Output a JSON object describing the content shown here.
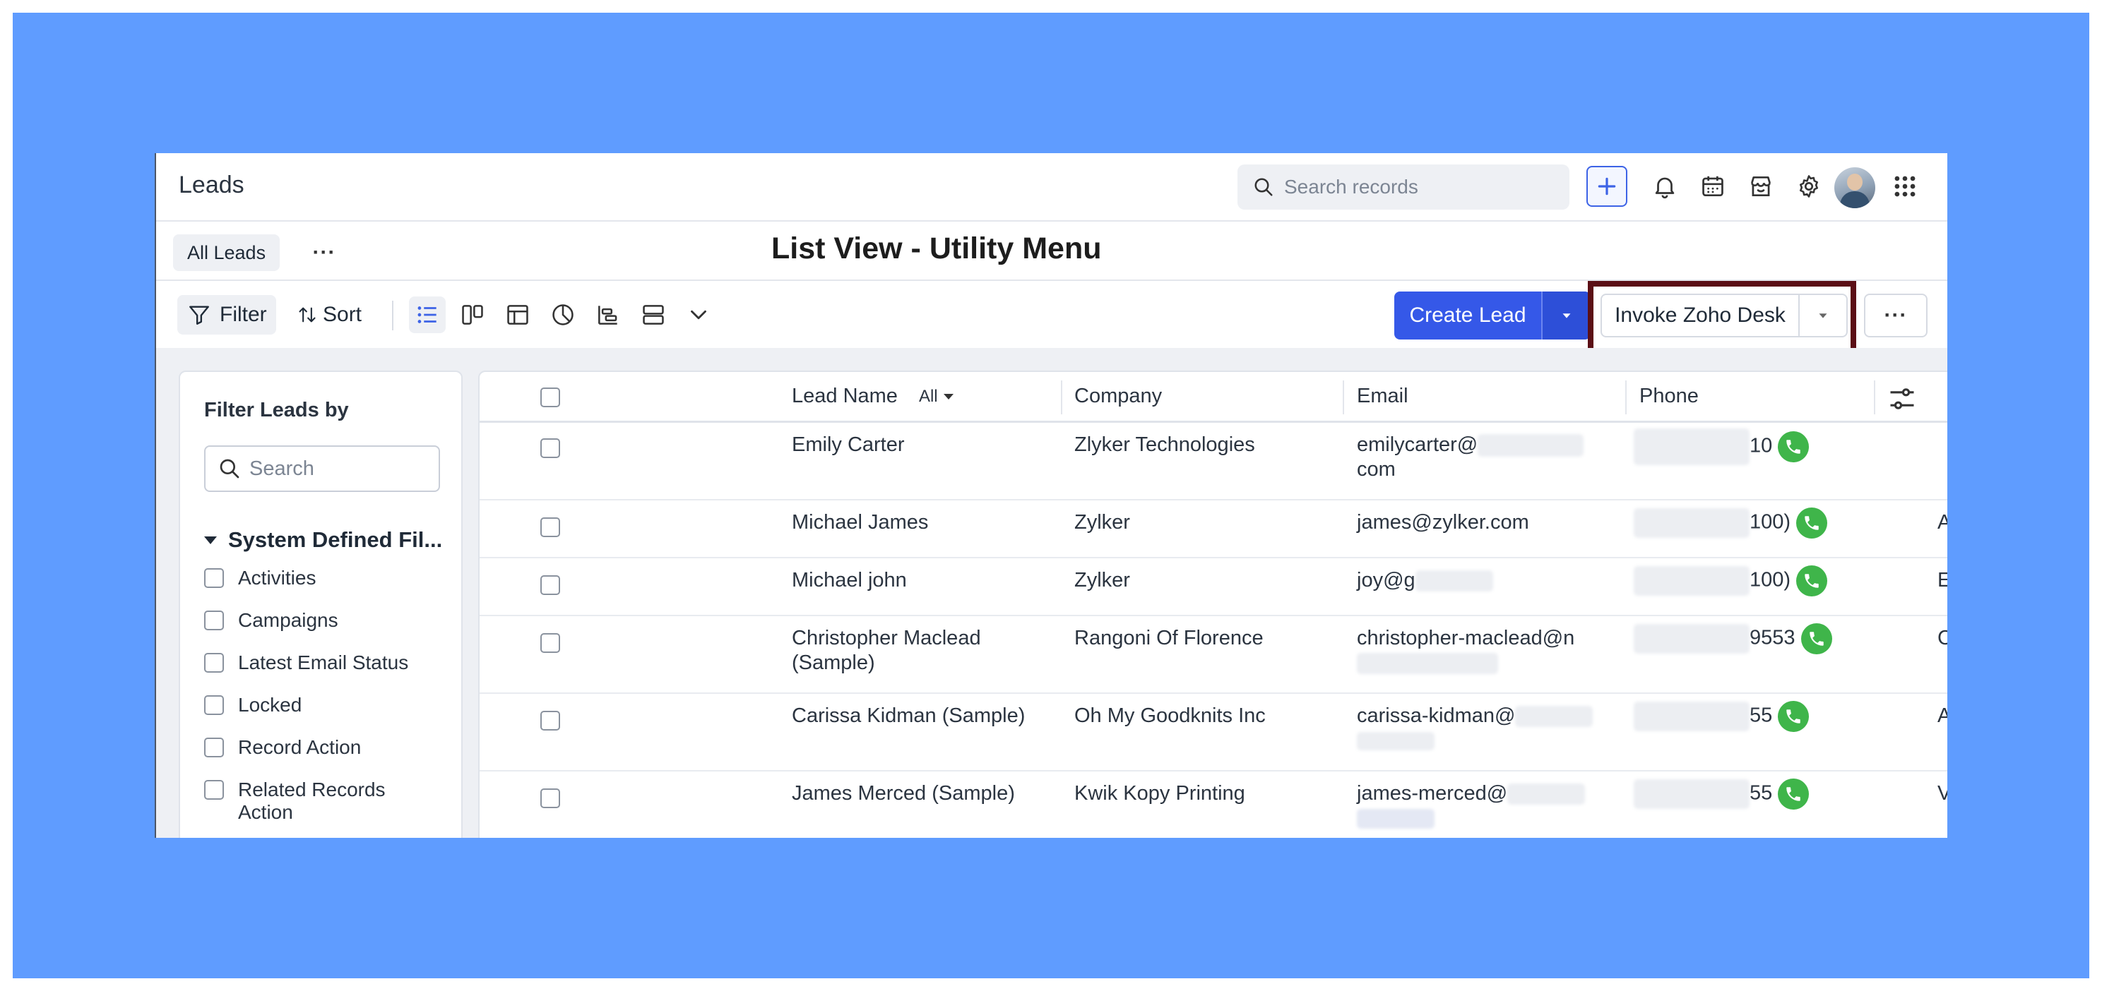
{
  "header": {
    "title": "Leads",
    "search_placeholder": "Search records"
  },
  "tabs": {
    "active": "All Leads",
    "more": "···"
  },
  "overlay_title": "List View - Utility Menu",
  "toolbar": {
    "filter_label": "Filter",
    "sort_label": "Sort",
    "create_label": "Create Lead",
    "invoke_label": "Invoke Zoho Desk",
    "more_label": "···"
  },
  "filter_panel": {
    "title": "Filter Leads by",
    "search_placeholder": "Search",
    "section_title": "System Defined Fil...",
    "items": [
      "Activities",
      "Campaigns",
      "Latest Email Status",
      "Locked",
      "Record Action",
      "Related Records Action"
    ]
  },
  "table": {
    "columns": {
      "lead_name": "Lead Name",
      "lead_filter": "All",
      "company": "Company",
      "email": "Email",
      "phone": "Phone"
    },
    "rows": [
      {
        "name": "Emily Carter",
        "company": "Zlyker Technologies",
        "email_line1": "emilycarter@",
        "email_line2": "com",
        "phone_tail": "10",
        "extra": ""
      },
      {
        "name": "Michael James",
        "company": "Zylker",
        "email_line1": "james@zylker.com",
        "email_line2": "",
        "phone_tail": "100)",
        "extra": "A"
      },
      {
        "name": "Michael john",
        "company": "Zylker",
        "email_line1": "joy@g",
        "email_line2": "",
        "phone_tail": "100)",
        "extra": "E"
      },
      {
        "name": "Christopher Maclead (Sample)",
        "company": "Rangoni Of Florence",
        "email_line1": "christopher-maclead@n",
        "email_line2": "",
        "phone_tail": "9553",
        "extra": "C"
      },
      {
        "name": "Carissa Kidman (Sample)",
        "company": "Oh My Goodknits Inc",
        "email_line1": "carissa-kidman@",
        "email_line2": "",
        "phone_tail": "55",
        "extra": "A"
      },
      {
        "name": "James Merced (Sample)",
        "company": "Kwik Kopy Printing",
        "email_line1": "james-merced@",
        "email_line2": "",
        "phone_tail": "55",
        "extra": "V"
      }
    ]
  },
  "colors": {
    "backdrop": "#5f9cff",
    "primary": "#3558e8",
    "highlight": "#5b0f16",
    "phone": "#3fb54a"
  }
}
